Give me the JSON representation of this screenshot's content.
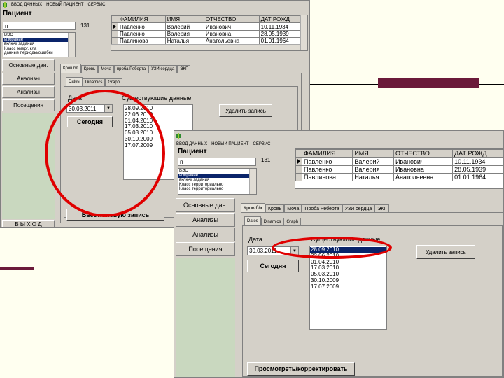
{
  "colors": {
    "highlight": "#e00000",
    "accent": "#6b1a3a",
    "selection": "#0a246a",
    "green": "#c9d8bf"
  },
  "menu": {
    "items": [
      "ВВОД ДАННЫХ",
      "НОВЫЙ ПАЦИЕНТ",
      "СЕРВИС"
    ]
  },
  "menu2": {
    "items": [
      "ВВОД ДАННЫХ",
      "НОВЫЙ ПАЦИЕНТ",
      "СЕРВИС"
    ]
  },
  "patient": {
    "label": "Пациент",
    "search": "п",
    "count": "131"
  },
  "patient_list1": [
    "ВЭС",
    "Избрание",
    "включ/ задания",
    "Класс эмерг. кла",
    "данные периоды/ошибки"
  ],
  "patient_list2": [
    "ВЭС",
    "Избрание",
    "включ/ задания",
    "Класс территориально",
    "Класс территориально"
  ],
  "table": {
    "headers": [
      "ФАМИЛИЯ",
      "ИМЯ",
      "ОТЧЕСТВО",
      "ДАТ РОЖД"
    ],
    "rows": [
      [
        "Павленко",
        "Валерий",
        "Иванович",
        "10.11.1934"
      ],
      [
        "Павленко",
        "Валерия",
        "Ивановна",
        "28.05.1939"
      ],
      [
        "Павлинова",
        "Наталья",
        "Анатольевна",
        "01.01.1964"
      ]
    ]
  },
  "table2": {
    "headers": [
      "ФАМИЛИЯ",
      "ИМЯ",
      "ОТЧЕСТВО",
      "ДАТ РОЖД"
    ],
    "rows": [
      [
        "Павленко",
        "Валерий",
        "Иванович",
        "10.11.1934"
      ],
      [
        "Павленко",
        "Валерия",
        "Ивановна",
        "28.05.1939"
      ],
      [
        "Павлинова",
        "Наталья",
        "Анатольевна",
        "01.01.1964"
      ]
    ]
  },
  "sidebar1": {
    "items": [
      "Основные дан.",
      "Анализы",
      "Анализы",
      "Посещения"
    ]
  },
  "sidebar2": {
    "items": [
      "Основные дан.",
      "Анализы",
      "Анализы",
      "Посещения"
    ]
  },
  "exit_label": "В Ы Х О Д",
  "tabs1": [
    "Кров.бл",
    "Кровь",
    "Моча",
    "проба Реберта",
    "УЗИ сердца",
    "ЭКГ"
  ],
  "tabs2": [
    "Кров б/х",
    "Кровь",
    "Моча",
    "Проба Реберта",
    "УЗИ сердца",
    "ЭКГ"
  ],
  "subtabs1": [
    "Dates",
    "Dinamics",
    "Graph"
  ],
  "subtabs2": [
    "Dates",
    "Dinamics",
    "Graph"
  ],
  "dates": {
    "date_label": "Дата",
    "existing_label": "Существующие данные",
    "date_value": "30.03.2011",
    "today_button": "Сегодня",
    "delete_button": "Удалить запись",
    "new_record_button": "Ввести новую запись",
    "list": [
      "28.09.2010",
      "22.06.2010",
      "01.04.2010",
      "17.03.2010",
      "05.03.2010",
      "30.10.2009",
      "17.07.2009"
    ]
  },
  "dates2": {
    "date_label": "Дата",
    "existing_label": "Существующие данные",
    "date_value": "30.03.2011",
    "today_button": "Сегодня",
    "delete_button": "Удалить запись",
    "view_button": "Просмотреть/корректировать",
    "list": [
      "28.09.2010",
      "22.06.2010",
      "01.04.2010",
      "17.03.2010",
      "05.03.2010",
      "30.10.2009",
      "17.07.2009"
    ]
  }
}
